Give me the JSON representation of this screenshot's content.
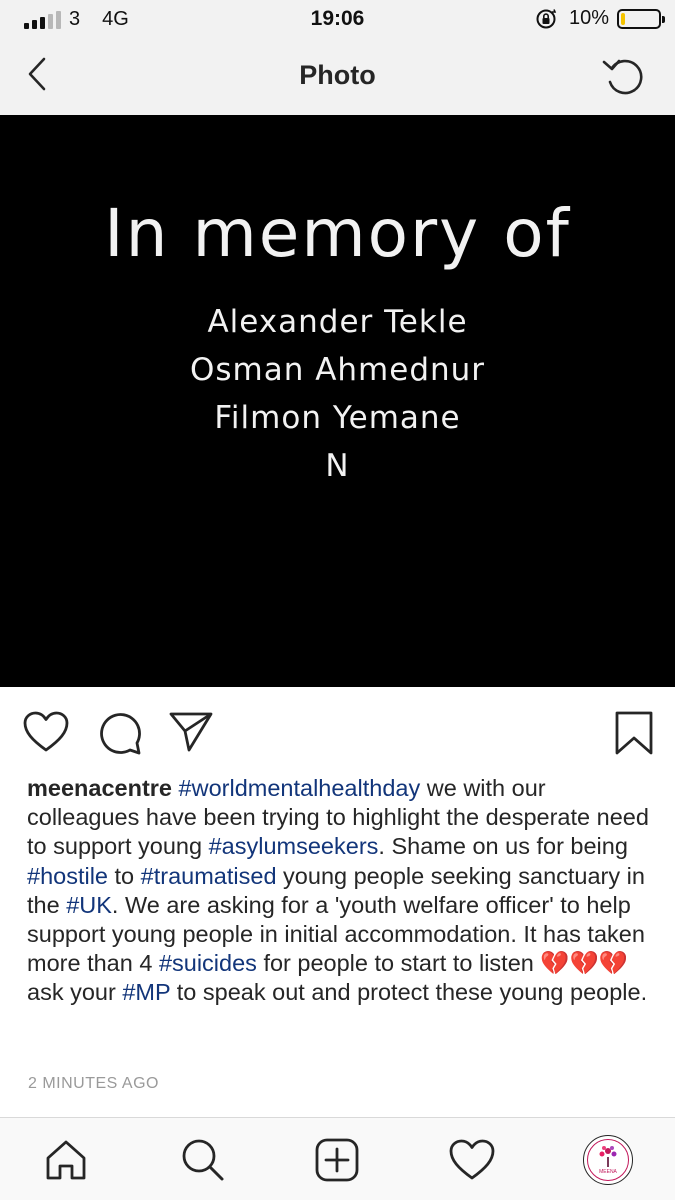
{
  "status_bar": {
    "signal_text": "3",
    "network": "4G",
    "time": "19:06",
    "battery_percent_text": "10%",
    "battery_level": 0.1,
    "battery_color": "#f5c400",
    "icons": [
      "signal-icon",
      "orientation-lock-icon",
      "battery-icon"
    ]
  },
  "nav": {
    "title": "Photo",
    "back_icon": "chevron-left-icon",
    "right_icon": "rotate-icon"
  },
  "photo": {
    "heading": "In memory of",
    "names": [
      "Alexander Tekle",
      "Osman Ahmednur",
      "Filmon Yemane",
      "N"
    ]
  },
  "actions": {
    "icons": [
      "heart-icon",
      "comment-icon",
      "share-icon",
      "bookmark-icon"
    ]
  },
  "caption": {
    "username": "meenacentre",
    "segments": [
      {
        "text": " ",
        "tag": false
      },
      {
        "text": "#worldmentalhealthday",
        "tag": true
      },
      {
        "text": " we with our colleagues have been trying to highlight the desperate need to support young ",
        "tag": false
      },
      {
        "text": "#asylumseekers",
        "tag": true
      },
      {
        "text": ". Shame on us for being ",
        "tag": false
      },
      {
        "text": "#hostile",
        "tag": true
      },
      {
        "text": " to ",
        "tag": false
      },
      {
        "text": "#traumatised",
        "tag": true
      },
      {
        "text": " young people seeking sanctuary in the ",
        "tag": false
      },
      {
        "text": "#UK",
        "tag": true
      },
      {
        "text": ". We are asking for a 'youth welfare officer' to help support young people in initial accommodation. It has taken more than 4 ",
        "tag": false
      },
      {
        "text": "#suicides",
        "tag": true
      },
      {
        "text": " for people to start to listen 💔💔💔 ask your ",
        "tag": false
      },
      {
        "text": "#MP",
        "tag": true
      },
      {
        "text": " to speak out and protect these young people.",
        "tag": false
      }
    ],
    "hashtag_color": "#12357a"
  },
  "timestamp": "2 MINUTES AGO",
  "tab_bar": {
    "icons": [
      "home-icon",
      "search-icon",
      "add-post-icon",
      "activity-heart-icon",
      "profile-avatar"
    ],
    "avatar_label": "MEENA"
  }
}
